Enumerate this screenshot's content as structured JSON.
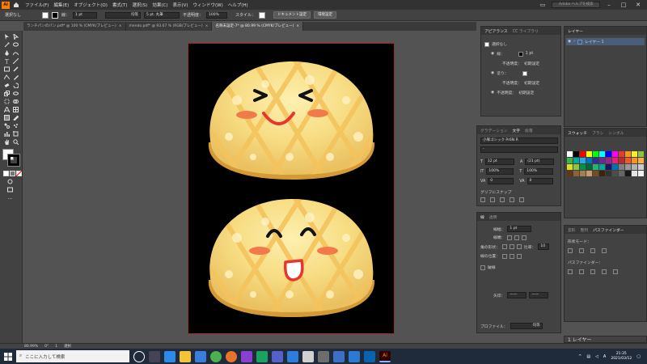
{
  "menubar": {
    "logo": "Ai",
    "items": [
      "ファイル(F)",
      "編集(E)",
      "オブジェクト(O)",
      "書式(T)",
      "選択(S)",
      "効果(C)",
      "表示(V)",
      "ウィンドウ(W)",
      "ヘルプ(H)"
    ],
    "search_placeholder": "Adobe ヘルプを検索"
  },
  "control_bar": {
    "selection_label": "選択なし",
    "stroke_label": "線：",
    "stroke_value": "1 pt",
    "profile_label": "均等",
    "brush_label": "5 pt. 丸筆",
    "opacity_label": "不透明度：",
    "opacity_value": "100%",
    "style_label": "スタイル：",
    "doc_settings_button": "ドキュメント設定",
    "prefs_button": "環境設定"
  },
  "tabs": [
    {
      "label": "ランチパンのパン.pdf* @ 100 % (CMYK/プレビュー)",
      "active": false
    },
    {
      "label": "mendo.pdf* @ 93.67 % (RGB/プレビュー)",
      "active": false
    },
    {
      "label": "名称未設定-7* @ 80.99 % (CMYK/プレビュー)",
      "active": true
    }
  ],
  "appearance_panel": {
    "tabs": [
      "アピアランス",
      "CC ライブラリ"
    ],
    "selection": "選択なし",
    "stroke_label": "線：",
    "stroke_value": "1 pt",
    "fill_label": "塗り：",
    "opacity_label": "不透明度：",
    "opacity_value": "初期設定"
  },
  "type_panel": {
    "tabs": [
      "グラデーション",
      "文字",
      "段落"
    ],
    "font": "小塚ゴシック Pr6N R",
    "style": "-",
    "size": "12 pt",
    "leading": "(21 pt)",
    "vscale": "100%",
    "hscale": "100%",
    "tracking": "0",
    "kerning": "0",
    "snap_label": "グリフにスナップ"
  },
  "stroke_panel": {
    "tabs": [
      "線",
      "透明"
    ],
    "weight_label": "線幅：",
    "weight_value": "1 pt",
    "cap_label": "線端：",
    "corner_label": "角の形状：",
    "limit_label": "比率：",
    "limit_value": "10",
    "align_label": "線の位置：",
    "dashed_label": "破線",
    "arrow_label": "矢印：",
    "profile_label": "プロファイル：",
    "profile_value": "均等"
  },
  "layers_panel": {
    "tabs": [
      "レイヤー"
    ],
    "layer_name": "レイヤー 1",
    "footer": "1 レイヤー"
  },
  "swatches_panel": {
    "tabs": [
      "スウォッチ",
      "ブラシ",
      "シンボル"
    ]
  },
  "pathfinder_panel": {
    "tabs": [
      "変形",
      "整列",
      "パスファインダー"
    ],
    "shape_modes": "形状モード：",
    "pathfinders": "パスファインダー："
  },
  "status": {
    "zoom": "80.99%",
    "rotation": "0°",
    "artboard": "1",
    "mode": "選択"
  },
  "taskbar": {
    "search_placeholder": "ここに入力して検索",
    "time": "21:35",
    "date": "2021/03/12"
  },
  "colors": {
    "bun_light": "#f9e08a",
    "bun_base": "#f1c654",
    "bun_dark": "#d9a13a",
    "cheek": "#f27a4a",
    "mouth": "#e8352d",
    "accent": "#ff7c00"
  }
}
